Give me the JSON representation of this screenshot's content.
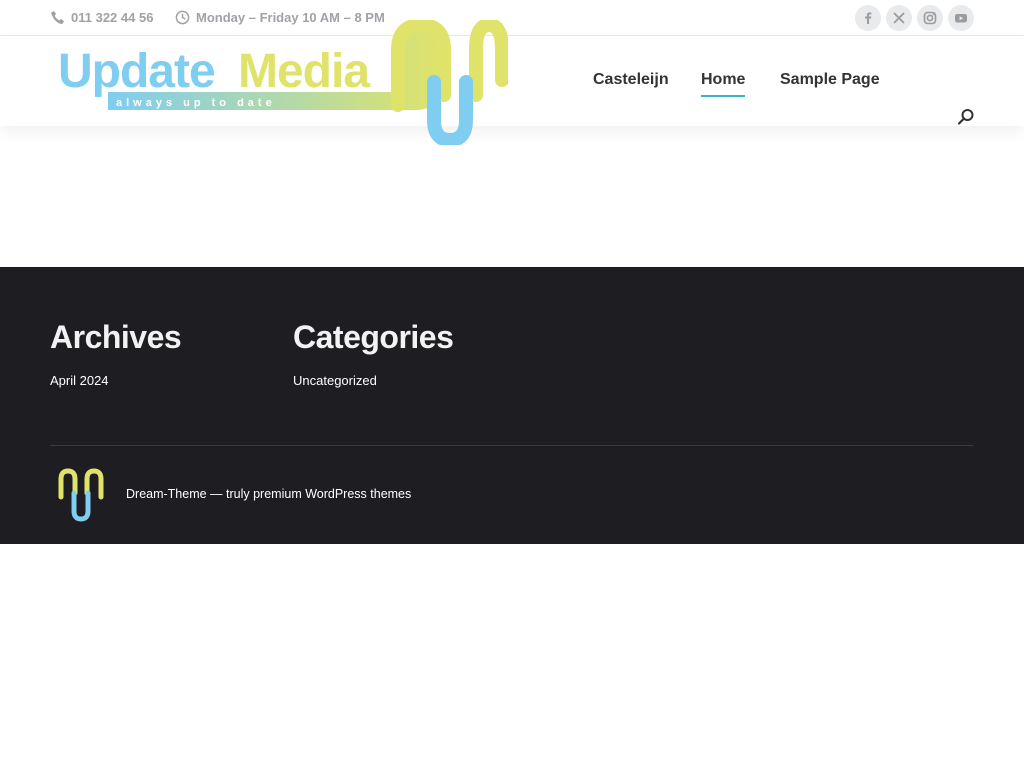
{
  "topbar": {
    "phone": "011 322 44 56",
    "hours": "Monday – Friday 10 AM – 8 PM",
    "social": [
      {
        "icon": "facebook-icon",
        "label": "f"
      },
      {
        "icon": "x-icon",
        "label": "X"
      },
      {
        "icon": "instagram-icon",
        "label": "instagram"
      },
      {
        "icon": "youtube-icon",
        "label": "youtube"
      }
    ]
  },
  "logo": {
    "word1": "Update",
    "word2": "Media",
    "tagline": "always up to date",
    "colors": {
      "blue": "#7fcdf0",
      "yellow": "#dfe36a"
    }
  },
  "nav": {
    "items": [
      "Casteleijn",
      "Home",
      "Sample Page"
    ],
    "active": "Home",
    "accent": "#3bb6c4"
  },
  "footer": {
    "archives_title": "Archives",
    "archives_link": "April 2024",
    "categories_title": "Categories",
    "categories_link": "Uncategorized",
    "credit": "Dream-Theme — truly premium WordPress themes",
    "background": "#1e1e22"
  }
}
